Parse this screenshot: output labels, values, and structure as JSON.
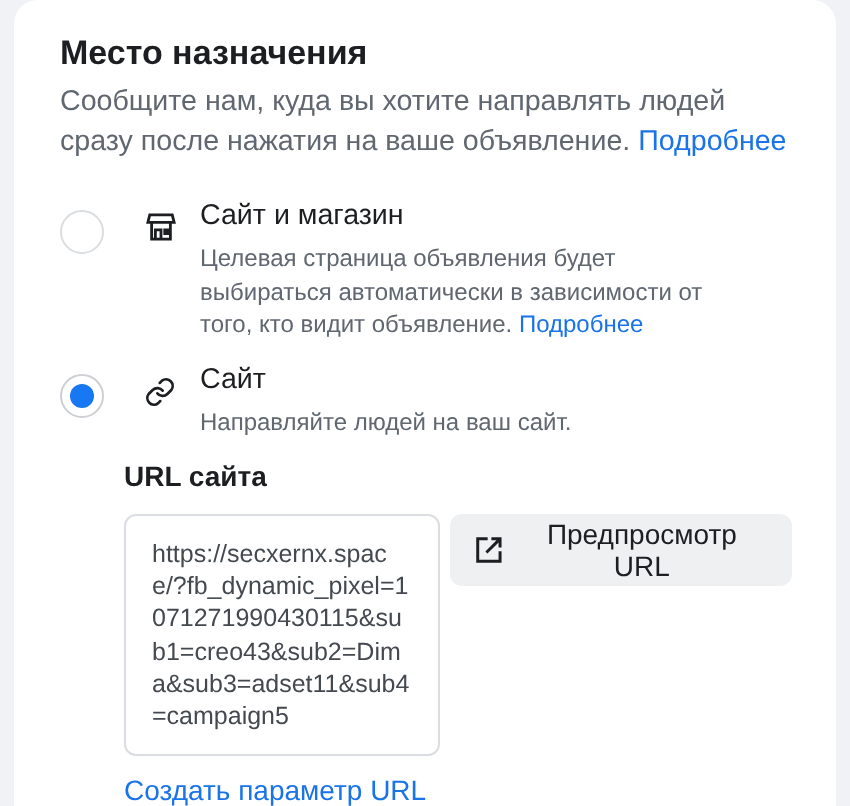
{
  "section": {
    "title": "Место назначения",
    "description": "Сообщите нам, куда вы хотите направлять людей сразу после нажатия на ваше объявление.",
    "learn_more": "Подробнее"
  },
  "options": [
    {
      "kind": "shop",
      "title": "Сайт и магазин",
      "description": "Целевая страница объявления будет выбираться автоматически в зависимости от того, кто видит объявление.",
      "learn_more": "Подробнее",
      "selected": false
    },
    {
      "kind": "link",
      "title": "Сайт",
      "description": "Направляйте людей на ваш сайт.",
      "selected": true
    }
  ],
  "url": {
    "label": "URL сайта",
    "value": "https://secxernx.space/?fb_dynamic_pixel=1071271990430115&sub1=creo43&sub2=Dima&sub3=adset11&sub4=campaign5",
    "preview_button": "Предпросмотр URL",
    "create_param_link": "Создать параметр URL"
  }
}
